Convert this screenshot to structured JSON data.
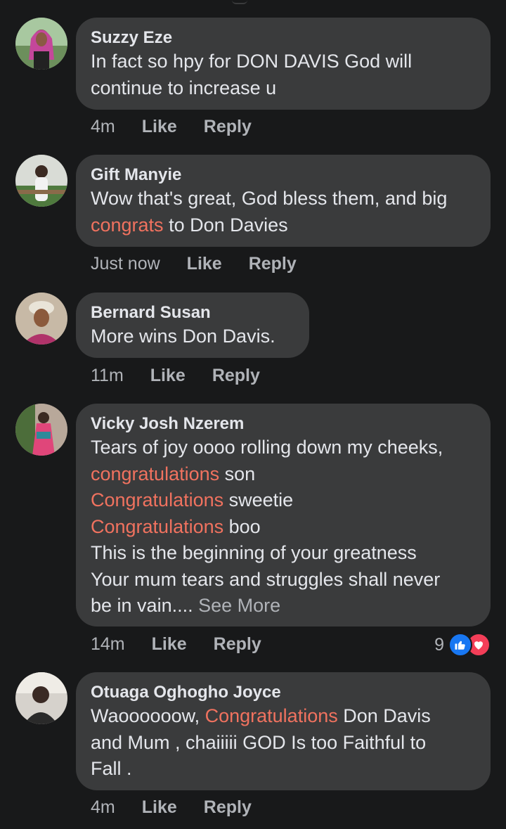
{
  "comments": [
    {
      "author": "Suzzy Eze",
      "lines": [
        [
          "In fact so hpy for DON DAVIS God will"
        ],
        [
          "continue to increase u"
        ]
      ],
      "time": "4m",
      "like": "Like",
      "reply": "Reply"
    },
    {
      "author": "Gift Manyie",
      "l1": "Wow that's great, God bless them, and big",
      "l2_hl": "congrats",
      "l2_rest": " to Don Davies",
      "time": "Just now",
      "like": "Like",
      "reply": "Reply"
    },
    {
      "author": "Bernard Susan",
      "l1": "More wins Don Davis.",
      "time": "11m",
      "like": "Like",
      "reply": "Reply"
    },
    {
      "author": "Vicky Josh Nzerem",
      "l1": "Tears of joy oooo rolling down my cheeks,",
      "l2_hl": "congratulations",
      "l2_rest": " son",
      "l3_hl": "Congratulations",
      "l3_rest": " sweetie",
      "l4_hl": "Congratulations",
      "l4_rest": " boo",
      "l5": "This is the beginning of your greatness",
      "l6": "Your mum tears and struggles shall never",
      "l7": "be in vain....",
      "see_more": "See More",
      "time": "14m",
      "like": "Like",
      "reply": "Reply",
      "reaction_count": "9",
      "reaction_icons": [
        "like-reaction-icon",
        "love-reaction-icon"
      ]
    },
    {
      "author": "Otuaga Oghogho Joyce",
      "l1_pre": "Waoooooow, ",
      "l1_hl": "Congratulations",
      "l1_rest": " Don Davis",
      "l2": "and Mum , chaiiiii GOD Is too Faithful to",
      "l3": "Fall .",
      "time": "4m",
      "like": "Like",
      "reply": "Reply"
    }
  ],
  "colors": {
    "background": "#18191a",
    "bubble": "#3a3b3c",
    "highlight": "#f0725f",
    "muted": "#b0b3b8",
    "like_blue": "#1877f2",
    "love_red": "#f33e58"
  }
}
